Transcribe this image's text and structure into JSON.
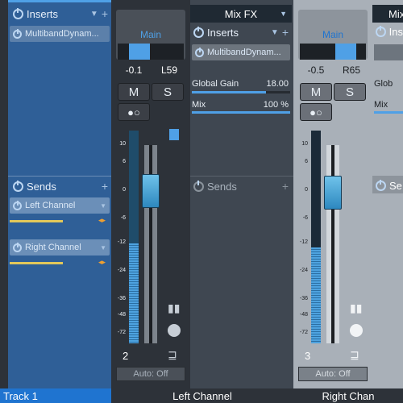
{
  "left_track": {
    "inserts_label": "Inserts",
    "insert_slot": "MultibandDynam...",
    "sends_label": "Sends",
    "sends": [
      {
        "name": "Left Channel"
      },
      {
        "name": "Right Channel"
      }
    ],
    "name": "Track 1"
  },
  "left_channel": {
    "main_label": "Main",
    "pan_value": "-0.1",
    "pan_readout": "L59",
    "mute_label": "M",
    "solo_label": "S",
    "scale": [
      "10",
      "6",
      "0",
      "-6",
      "-12",
      "-24",
      "-36",
      "-48",
      "-72"
    ],
    "number": "2",
    "auto_label": "Auto: Off",
    "name": "Left Channel"
  },
  "fx_channel": {
    "title": "Mix FX",
    "inserts_label": "Inserts",
    "insert_slot": "MultibandDynam...",
    "param1_label": "Global Gain",
    "param1_value": "18.00",
    "param1_level": 0.75,
    "param2_label": "Mix",
    "param2_value": "100 %",
    "param2_level": 1.0,
    "sends_label": "Sends"
  },
  "right_channel": {
    "main_label": "Main",
    "pan_value": "-0.5",
    "pan_readout": "R65",
    "mute_label": "M",
    "solo_label": "S",
    "scale": [
      "10",
      "6",
      "0",
      "-6",
      "-12",
      "-24",
      "-36",
      "-48",
      "-72"
    ],
    "number": "3",
    "auto_label": "Auto: Off",
    "name": "Right Chan"
  },
  "partial_fx": {
    "title": "Mix",
    "inserts_label": "Ins",
    "param1_label": "Glob",
    "param2_label": "Mix",
    "sends_label": "Se"
  },
  "colors": {
    "accent": "#4fa0e6",
    "meter": "#4ea3e0"
  }
}
